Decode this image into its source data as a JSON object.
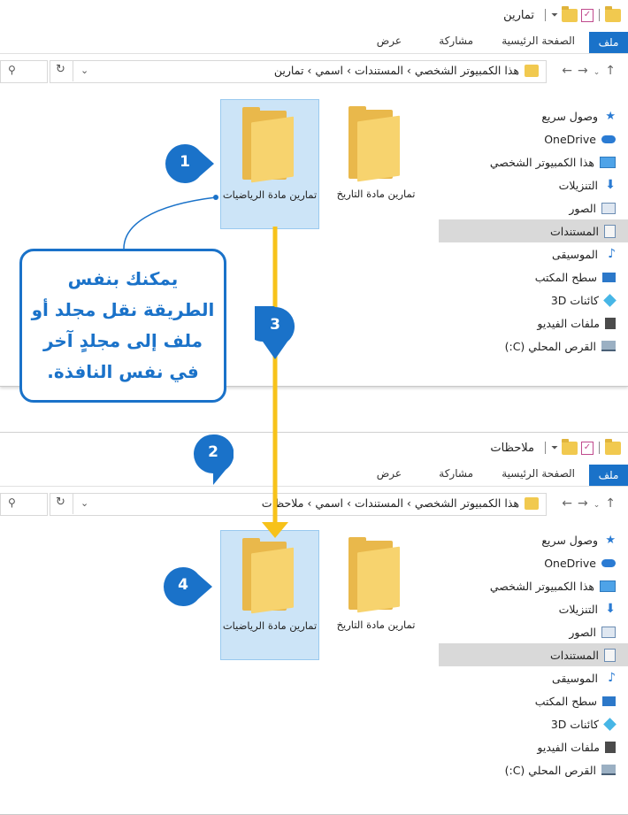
{
  "top_window": {
    "title": "تمارين",
    "ribbon": {
      "file": "ملف",
      "home": "الصفحة الرئيسية",
      "share": "مشاركة",
      "view": "عرض"
    },
    "address": {
      "path": [
        "هذا الكمبيوتر الشخصي",
        "المستندات",
        "اسمي",
        "تمارين"
      ],
      "path_text": "هذا الكمبيوتر الشخصي  ›  المستندات  ›  اسمي  ›  تمارين"
    },
    "files": [
      {
        "name": "تمارين مادة التاريخ",
        "selected": false
      },
      {
        "name": "تمارين مادة الرياضيات",
        "selected": true
      }
    ]
  },
  "bottom_window": {
    "title": "ملاحظات",
    "ribbon": {
      "file": "ملف",
      "home": "الصفحة الرئيسية",
      "share": "مشاركة",
      "view": "عرض"
    },
    "address": {
      "path": [
        "هذا الكمبيوتر الشخصي",
        "المستندات",
        "اسمي",
        "ملاحظات"
      ],
      "path_text": "هذا الكمبيوتر الشخصي  ›  المستندات  ›  اسمي  ›  ملاحظات"
    },
    "files": [
      {
        "name": "تمارين مادة التاريخ",
        "selected": false
      },
      {
        "name": "تمارين مادة الرياضيات",
        "selected": true
      }
    ]
  },
  "sidebar": {
    "items": [
      {
        "label": "وصول سريع",
        "icon": "star-icon"
      },
      {
        "label": "OneDrive",
        "icon": "cloud-icon"
      },
      {
        "label": "هذا الكمبيوتر الشخصي",
        "icon": "pc-icon"
      },
      {
        "label": "التنزيلات",
        "icon": "download-icon"
      },
      {
        "label": "الصور",
        "icon": "pictures-icon"
      },
      {
        "label": "المستندات",
        "icon": "documents-icon",
        "selected": true
      },
      {
        "label": "الموسيقى",
        "icon": "music-icon"
      },
      {
        "label": "سطح المكتب",
        "icon": "desktop-icon"
      },
      {
        "label": "كائنات 3D",
        "icon": "3d-objects-icon"
      },
      {
        "label": "ملفات الفيديو",
        "icon": "video-icon"
      },
      {
        "label": "القرص المحلي (C:)",
        "icon": "disk-icon"
      }
    ]
  },
  "steps": [
    "1",
    "2",
    "3",
    "4"
  ],
  "callout": {
    "lines": [
      "يمكنك بنفس",
      "الطريقة نقل مجلد أو",
      "ملف إلى مجلدٍ آخر",
      "في نفس النافذة."
    ]
  },
  "colors": {
    "accent": "#1a72c9",
    "arrow": "#f7c21a",
    "folder": "#f7d36e",
    "selection": "#cce4f7"
  }
}
